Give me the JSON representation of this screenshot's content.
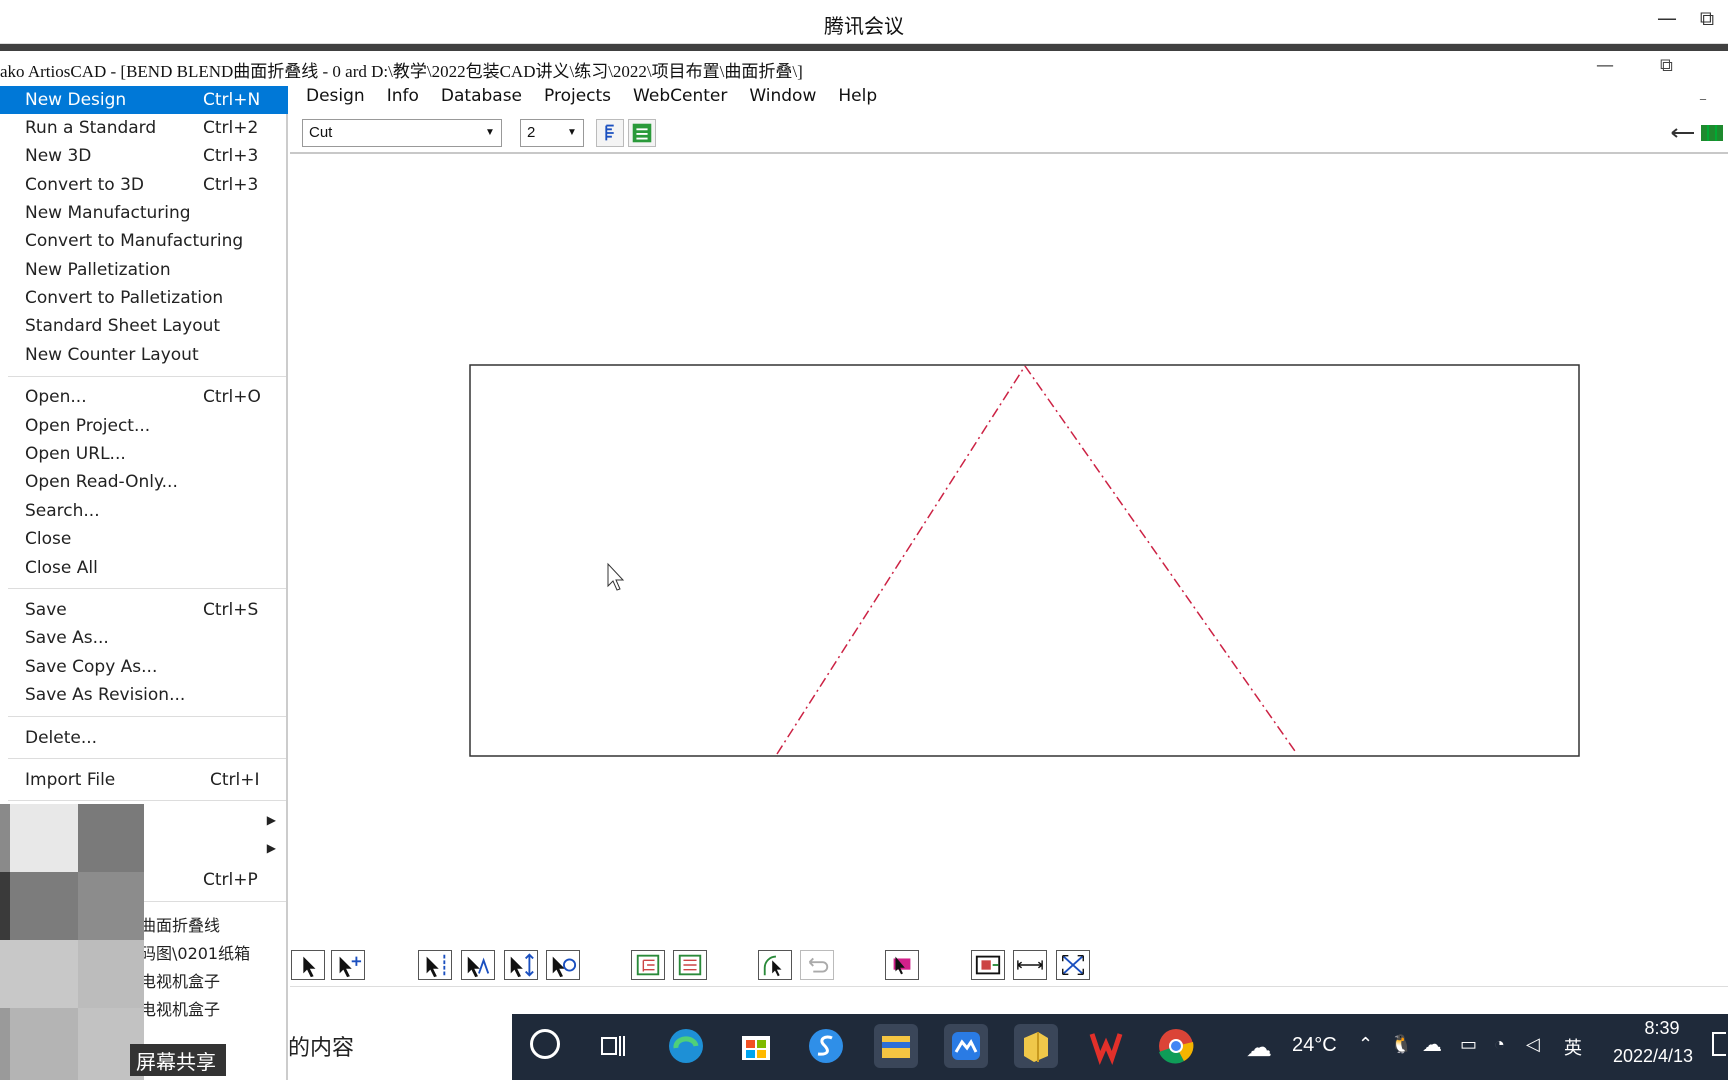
{
  "meeting": {
    "title": "腾讯会议",
    "minimize": "—",
    "restore": "⧉"
  },
  "app": {
    "title": "ako ArtiosCAD - [BEND  BLEND曲面折叠线 - 0 ard D:\\教学\\2022包装CAD讲义\\练习\\2022\\项目布置\\曲面折叠\\]",
    "minimize": "—",
    "restore": "⧉"
  },
  "menubar": [
    "Design",
    "Info",
    "Database",
    "Projects",
    "WebCenter",
    "Window",
    "Help"
  ],
  "toolbar": {
    "linetype": "Cut",
    "pointsize": "2"
  },
  "file_menu": {
    "groups": [
      [
        {
          "label": "New Design",
          "shortcut": "Ctrl+N",
          "highlighted": true
        },
        {
          "label": "Run a Standard",
          "shortcut": "Ctrl+2"
        },
        {
          "label": "New 3D",
          "shortcut": "Ctrl+3"
        },
        {
          "label": "Convert to 3D",
          "shortcut": "Ctrl+3"
        },
        {
          "label": "New Manufacturing",
          "shortcut": ""
        },
        {
          "label": "Convert to Manufacturing",
          "shortcut": ""
        },
        {
          "label": "New Palletization",
          "shortcut": ""
        },
        {
          "label": "Convert to Palletization",
          "shortcut": ""
        },
        {
          "label": "Standard Sheet Layout",
          "shortcut": ""
        },
        {
          "label": "New Counter Layout",
          "shortcut": ""
        }
      ],
      [
        {
          "label": "Open...",
          "shortcut": "Ctrl+O"
        },
        {
          "label": "Open Project...",
          "shortcut": ""
        },
        {
          "label": "Open URL...",
          "shortcut": ""
        },
        {
          "label": "Open Read-Only...",
          "shortcut": ""
        },
        {
          "label": "Search...",
          "shortcut": ""
        },
        {
          "label": "Close",
          "shortcut": ""
        },
        {
          "label": "Close All",
          "shortcut": ""
        }
      ],
      [
        {
          "label": "Save",
          "shortcut": "Ctrl+S"
        },
        {
          "label": "Save As...",
          "shortcut": ""
        },
        {
          "label": "Save Copy As...",
          "shortcut": ""
        },
        {
          "label": "Save As Revision...",
          "shortcut": ""
        }
      ],
      [
        {
          "label": "Delete...",
          "shortcut": ""
        }
      ],
      [
        {
          "label": "Import File",
          "shortcut": "Ctrl+I"
        }
      ]
    ],
    "print_shortcut": "Ctrl+P",
    "recent_files": [
      "曲面折叠线",
      "码图\\0201纸箱",
      "电视机盒子",
      "电视机盒子"
    ]
  },
  "screen_share_label": "屏幕共享",
  "notification_text": "的内容",
  "taskbar": {
    "weather": "24°C",
    "ime": "英",
    "time": "8:39",
    "date": "2022/4/13"
  },
  "colors": {
    "accent": "#0078d7",
    "crease_line": "#cc2244",
    "taskbar": "#1f2a3a"
  }
}
